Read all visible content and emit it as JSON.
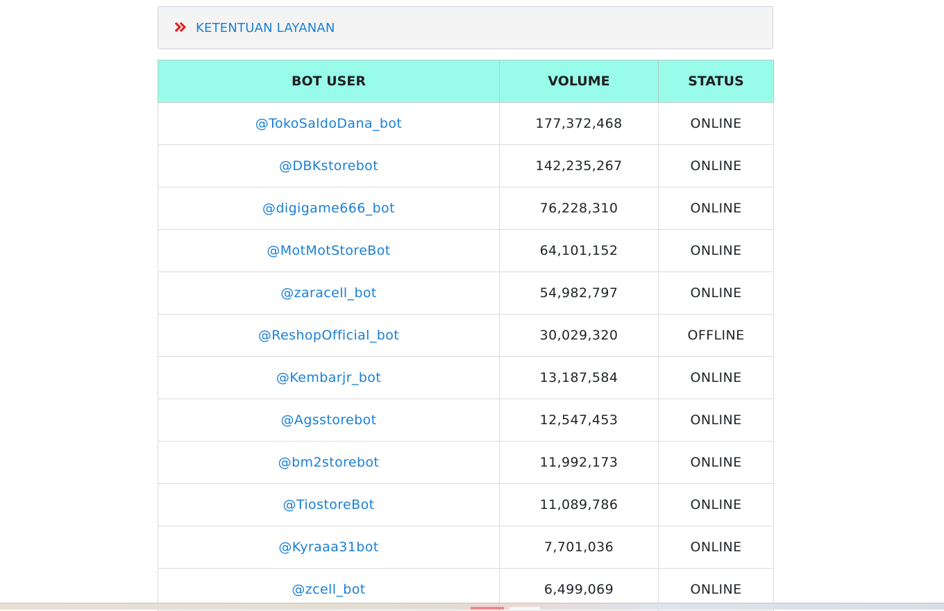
{
  "tos": {
    "label": "KETENTUAN LAYANAN",
    "icon": "double-chevron-right-icon",
    "icon_color": "#e21b1b"
  },
  "colors": {
    "header_bg": "#99fbe9",
    "link": "#1a7fd4"
  },
  "table": {
    "headers": {
      "user": "BOT USER",
      "volume": "VOLUME",
      "status": "STATUS"
    },
    "rows": [
      {
        "user": "@TokoSaldoDana_bot",
        "volume": "177,372,468",
        "status": "ONLINE"
      },
      {
        "user": "@DBKstorebot",
        "volume": "142,235,267",
        "status": "ONLINE"
      },
      {
        "user": "@digigame666_bot",
        "volume": "76,228,310",
        "status": "ONLINE"
      },
      {
        "user": "@MotMotStoreBot",
        "volume": "64,101,152",
        "status": "ONLINE"
      },
      {
        "user": "@zaracell_bot",
        "volume": "54,982,797",
        "status": "ONLINE"
      },
      {
        "user": "@ReshopOfficial_bot",
        "volume": "30,029,320",
        "status": "OFFLINE"
      },
      {
        "user": "@Kembarjr_bot",
        "volume": "13,187,584",
        "status": "ONLINE"
      },
      {
        "user": "@Agsstorebot",
        "volume": "12,547,453",
        "status": "ONLINE"
      },
      {
        "user": "@bm2storebot",
        "volume": "11,992,173",
        "status": "ONLINE"
      },
      {
        "user": "@TiostoreBot",
        "volume": "11,089,786",
        "status": "ONLINE"
      },
      {
        "user": "@Kyraaa31bot",
        "volume": "7,701,036",
        "status": "ONLINE"
      },
      {
        "user": "@zcell_bot",
        "volume": "6,499,069",
        "status": "ONLINE"
      }
    ]
  }
}
